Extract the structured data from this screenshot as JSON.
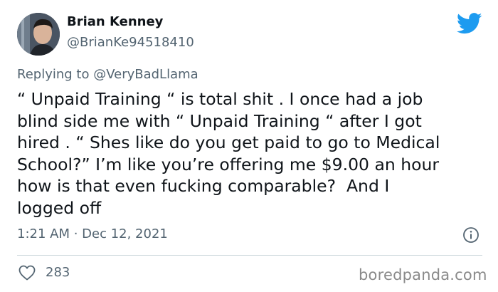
{
  "author": {
    "name": "Brian Kenney",
    "handle": "@BrianKe94518410"
  },
  "reply": {
    "prefix": "Replying to ",
    "mention": "@VeryBadLlama"
  },
  "tweet": {
    "text": "“ Unpaid Training “ is total shit . I once had a job\nblind side me with “ Unpaid Training “ after I got\nhired . “ Shes like do you get paid to go to Medical\nSchool?” I’m like you’re offering me $9.00 an hour\nhow is that even fucking comparable?  And I\nlogged off",
    "timestamp": "1:21 AM · Dec 12, 2021"
  },
  "stats": {
    "likes": "283"
  },
  "watermark": "boredpanda.com",
  "icons": {
    "brand": "twitter-bird-icon",
    "info": "info-icon",
    "like": "heart-icon"
  },
  "colors": {
    "twitter_blue": "#1d9bf0",
    "secondary_text": "#536471",
    "divider": "#cfd9de"
  }
}
